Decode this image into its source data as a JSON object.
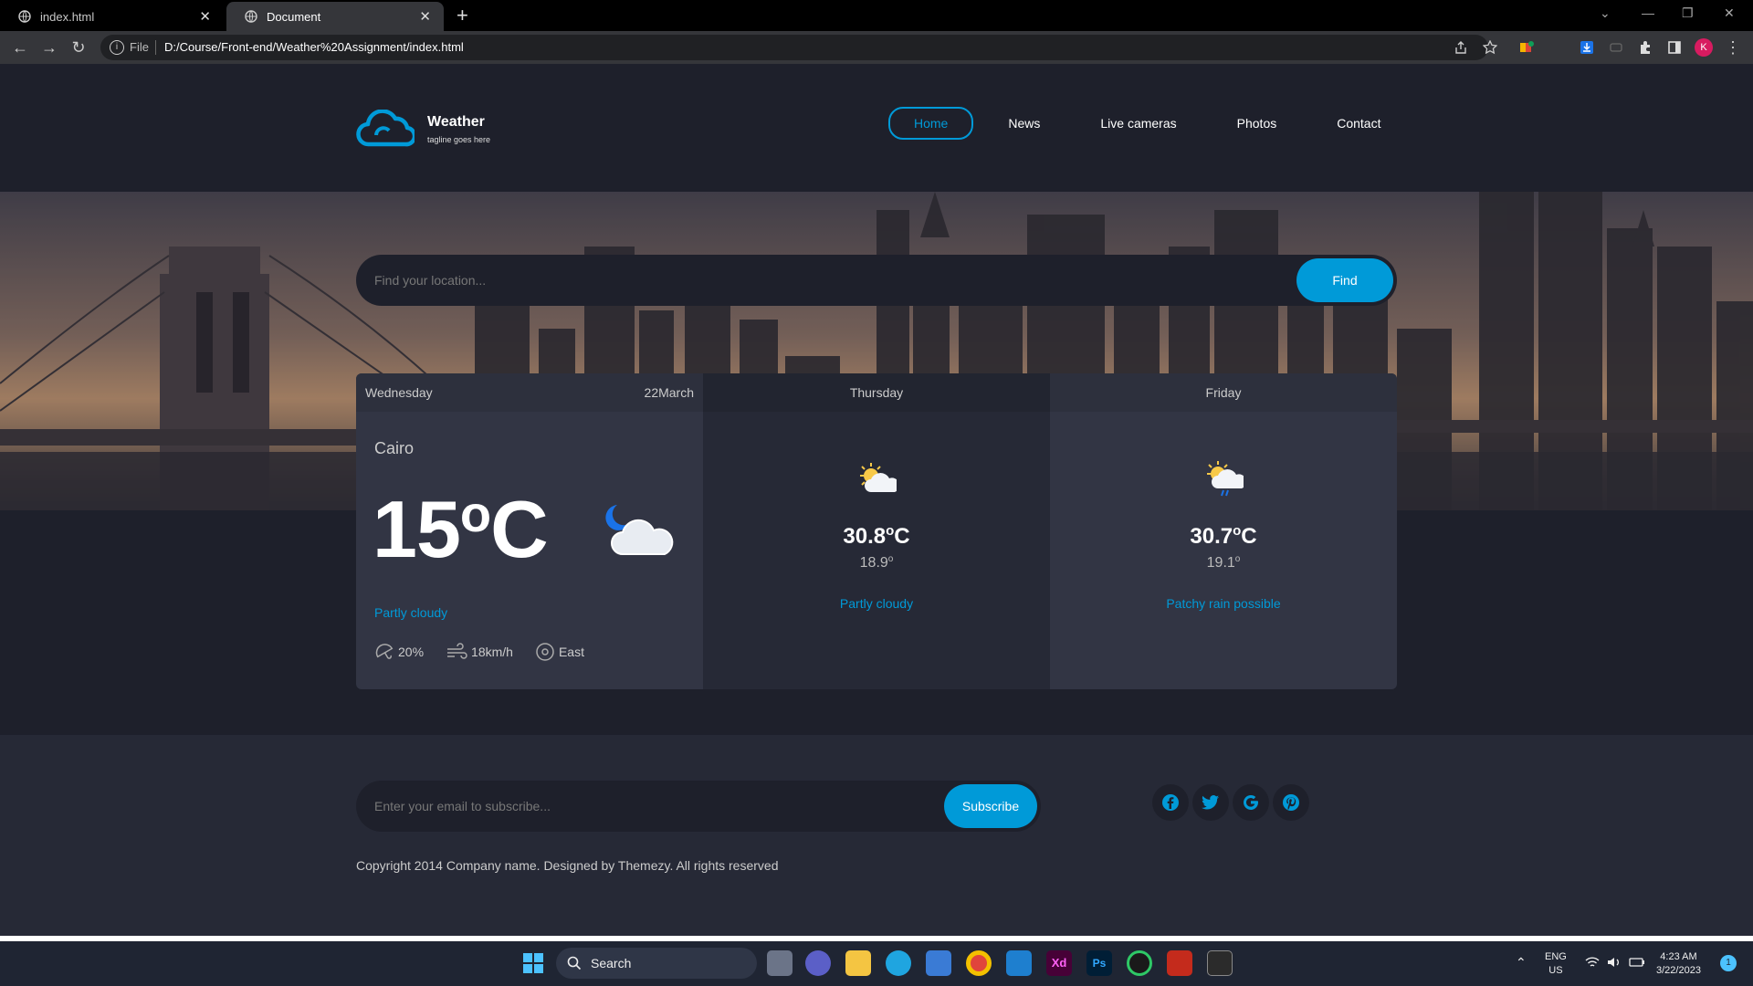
{
  "browser": {
    "tabs": [
      {
        "title": "index.html",
        "active": false
      },
      {
        "title": "Document",
        "active": true
      }
    ],
    "address": {
      "scheme_label": "File",
      "url": "D:/Course/Front-end/Weather%20Assignment/index.html"
    }
  },
  "header": {
    "brand_name": "Weather",
    "tagline": "tagline goes here",
    "nav": [
      {
        "label": "Home",
        "active": true
      },
      {
        "label": "News",
        "active": false
      },
      {
        "label": "Live cameras",
        "active": false
      },
      {
        "label": "Photos",
        "active": false
      },
      {
        "label": "Contact",
        "active": false
      }
    ]
  },
  "search": {
    "placeholder": "Find your location...",
    "button_label": "Find"
  },
  "forecast": {
    "today": {
      "day": "Wednesday",
      "date": "22March",
      "city": "Cairo",
      "temp": "15",
      "unit_deg": "o",
      "unit": "C",
      "condition": "Partly cloudy",
      "rain": "20%",
      "wind": "18km/h",
      "direction": "East",
      "icon": "partly-cloudy-night-icon"
    },
    "days": [
      {
        "day": "Thursday",
        "max": "30.8",
        "max_deg": "o",
        "max_unit": "C",
        "min": "18.9",
        "min_deg": "o",
        "condition": "Partly cloudy",
        "icon": "partly-cloudy-day-icon"
      },
      {
        "day": "Friday",
        "max": "30.7",
        "max_deg": "o",
        "max_unit": "C",
        "min": "19.1",
        "min_deg": "o",
        "condition": "Patchy rain possible",
        "icon": "patchy-rain-icon"
      }
    ]
  },
  "footer": {
    "subscribe_placeholder": "Enter your email to subscribe...",
    "subscribe_button": "Subscribe",
    "socials": [
      "facebook-icon",
      "twitter-icon",
      "google-icon",
      "pinterest-icon"
    ],
    "copyright": "Copyright 2014 Company name. Designed by Themezy. All rights reserved"
  },
  "taskbar": {
    "search_label": "Search",
    "lang": "ENG",
    "region": "US",
    "time": "4:23 AM",
    "date": "3/22/2023",
    "notification_count": "1"
  },
  "colors": {
    "accent": "#009ad8",
    "background": "#1e202b",
    "card": "#323544",
    "footer": "#262936"
  }
}
